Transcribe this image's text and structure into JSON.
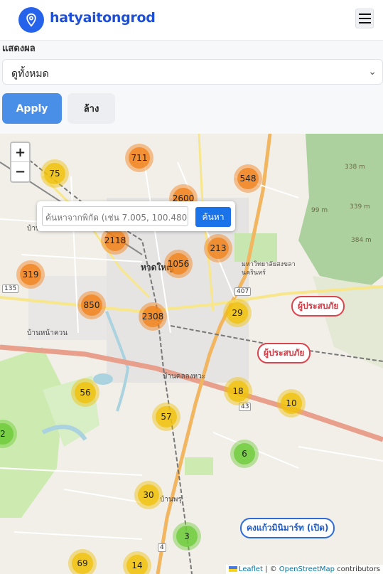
{
  "header": {
    "brand": "hatyaitongrod",
    "logo_icon": "map-pin-icon",
    "menu_icon": "hamburger-menu-icon"
  },
  "filters": {
    "label": "แสดงผล",
    "select_value": "ดูทั้งหมด",
    "apply_label": "Apply",
    "clear_label": "ล้าง"
  },
  "map": {
    "zoom_in": "+",
    "zoom_out": "−",
    "search_placeholder": "ค้นหาจากพิกัด (เช่น 7.005, 100.480)",
    "search_button": "ค้นหา",
    "clusters": [
      {
        "label": "711",
        "color": "orange"
      },
      {
        "label": "75",
        "color": "yellow"
      },
      {
        "label": "548",
        "color": "orange"
      },
      {
        "label": "2600",
        "color": "orange"
      },
      {
        "label": "2118",
        "color": "orange"
      },
      {
        "label": "213",
        "color": "orange"
      },
      {
        "label": "319",
        "color": "orange"
      },
      {
        "label": "1056",
        "color": "orange"
      },
      {
        "label": "850",
        "color": "orange"
      },
      {
        "label": "2308",
        "color": "orange"
      },
      {
        "label": "29",
        "color": "yellow"
      },
      {
        "label": "56",
        "color": "yellow"
      },
      {
        "label": "18",
        "color": "yellow"
      },
      {
        "label": "10",
        "color": "yellow"
      },
      {
        "label": "57",
        "color": "yellow"
      },
      {
        "label": "2",
        "color": "green"
      },
      {
        "label": "6",
        "color": "green"
      },
      {
        "label": "30",
        "color": "yellow"
      },
      {
        "label": "3",
        "color": "green"
      },
      {
        "label": "69",
        "color": "yellow"
      },
      {
        "label": "14",
        "color": "yellow"
      }
    ],
    "pills": [
      {
        "label": "ผู้ประสบภัย",
        "kind": "victim"
      },
      {
        "label": "ผู้ประสบภัย",
        "kind": "victim"
      },
      {
        "label": "คงแก้วมินิมาร์ท (เปิด)",
        "kind": "shop"
      }
    ],
    "labels": {
      "hatyai": "หาดใหญ่",
      "ban_bang_faen": "บ้านบางแฟน",
      "ban_na_kuan": "บ้านหน้าควน",
      "ban_khlong_hae": "บ้านคลองหวะ",
      "ban_phru": "บ้านพรุ",
      "university": "มหาวิทยาลัยสงขลานครินทร์",
      "elev_338": "338 m",
      "elev_99": "99 m",
      "elev_339": "339 m",
      "elev_384": "384 m"
    },
    "road_numbers": [
      "135",
      "407",
      "43",
      "4"
    ],
    "attribution": {
      "leaflet": "Leaflet",
      "sep": " | © ",
      "osm": "OpenStreetMap",
      "suffix": " contributors"
    }
  },
  "colors": {
    "primary": "#2563eb",
    "apply": "#4a8fe7",
    "victim": "#d8464e",
    "shop": "#2f6bd7"
  }
}
